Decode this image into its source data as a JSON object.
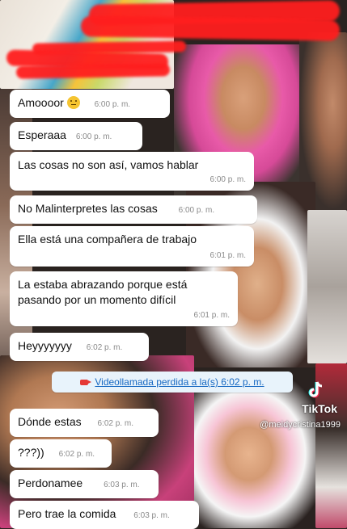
{
  "colors": {
    "bubble": "#ffffff",
    "time": "#8a8a8a",
    "system_link": "#1668c2",
    "redaction": "#ff1e1e"
  },
  "messages": [
    {
      "text": "Amoooor",
      "emoji": "confused-face-icon",
      "time": "6:00 p. m."
    },
    {
      "text": "Esperaaa",
      "time": "6:00 p. m."
    },
    {
      "text": "Las cosas no son así, vamos hablar",
      "time": "6:00 p. m."
    },
    {
      "text": "No Malinterpretes las cosas",
      "time": "6:00 p. m."
    },
    {
      "text": "Ella está una compañera de trabajo",
      "time": "6:01 p. m."
    },
    {
      "text": "La estaba abrazando porque está pasando por un momento difícil",
      "time": "6:01 p. m."
    },
    {
      "text": "Heyyyyyyy",
      "time": "6:02 p. m."
    },
    {
      "text": "Dónde estas",
      "time": "6:02 p. m."
    },
    {
      "text": "???))",
      "time": "6:02 p. m."
    },
    {
      "text": "Perdonamee",
      "time": "6:03 p. m."
    },
    {
      "text": "Pero trae la comida",
      "time": "6:03 p. m."
    }
  ],
  "system_message": {
    "icon": "missed-video-call-icon",
    "text": "Videollamada perdida a la(s) 6:02 p. m."
  },
  "watermark": {
    "brand": "TikTok",
    "handle": "@meidycristina1999",
    "icon": "tiktok-logo-icon"
  }
}
